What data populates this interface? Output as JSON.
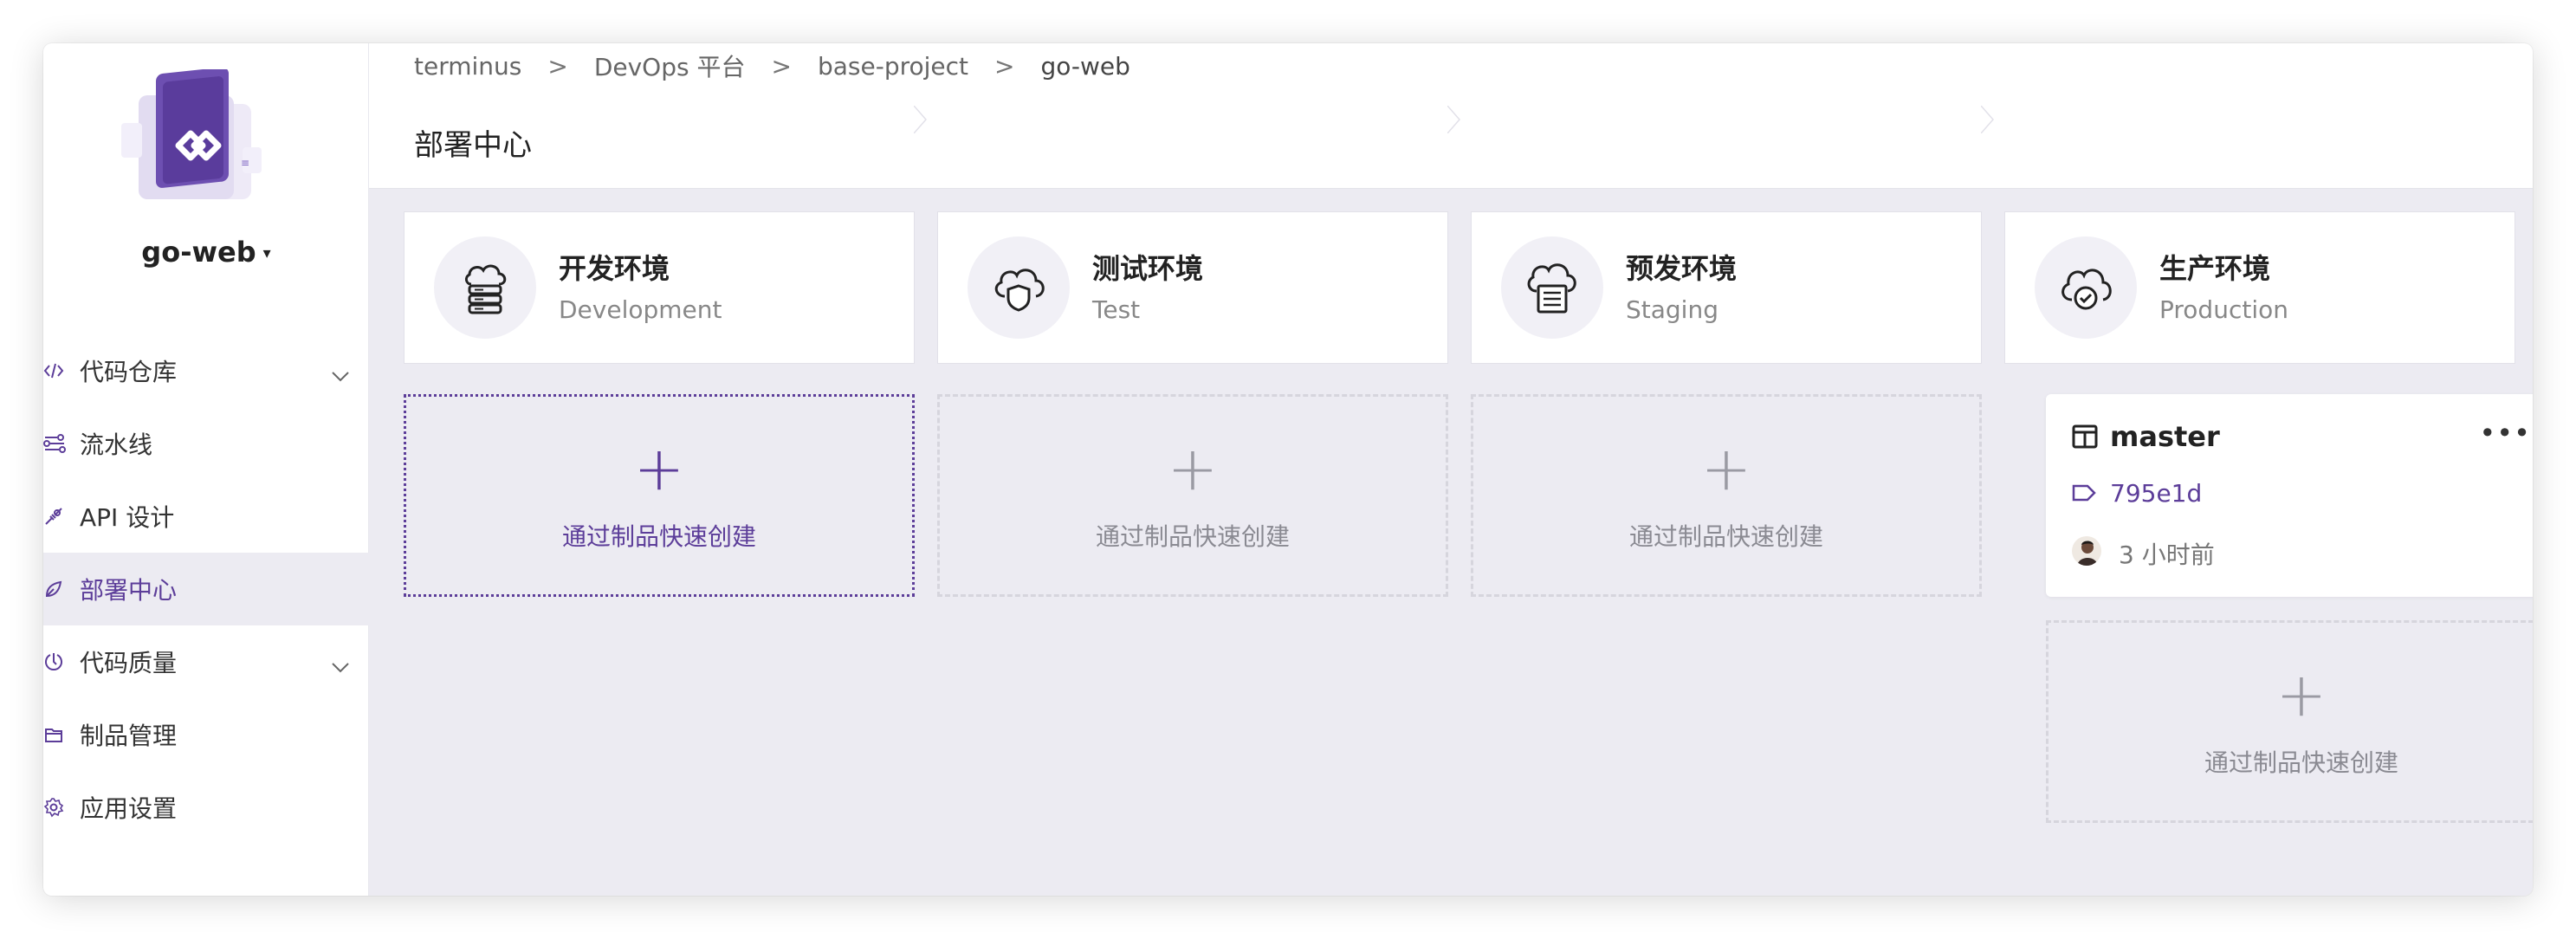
{
  "app": {
    "name": "go-web"
  },
  "sidebar": {
    "items": [
      {
        "label": "代码仓库",
        "icon": "code-icon",
        "expandable": true
      },
      {
        "label": "流水线",
        "icon": "pipeline-icon",
        "expandable": false
      },
      {
        "label": "API 设计",
        "icon": "api-icon",
        "expandable": false
      },
      {
        "label": "部署中心",
        "icon": "deploy-icon",
        "expandable": false,
        "active": true
      },
      {
        "label": "代码质量",
        "icon": "quality-icon",
        "expandable": true
      },
      {
        "label": "制品管理",
        "icon": "artifact-icon",
        "expandable": false
      },
      {
        "label": "应用设置",
        "icon": "settings-icon",
        "expandable": false
      }
    ]
  },
  "breadcrumb": {
    "items": [
      "terminus",
      "DevOps 平台",
      "base-project",
      "go-web"
    ],
    "separator": ">"
  },
  "page": {
    "title": "部署中心"
  },
  "environments": [
    {
      "name": "开发环境",
      "name_en": "Development",
      "icon": "server-cloud-icon"
    },
    {
      "name": "测试环境",
      "name_en": "Test",
      "icon": "shield-cloud-icon"
    },
    {
      "name": "预发环境",
      "name_en": "Staging",
      "icon": "document-cloud-icon"
    },
    {
      "name": "生产环境",
      "name_en": "Production",
      "icon": "check-cloud-icon"
    }
  ],
  "create": {
    "label": "通过制品快速创建",
    "plus": "+"
  },
  "deployment": {
    "branch": "master",
    "commit": "795e1d",
    "time": "3 小时前",
    "more": "•••"
  },
  "colors": {
    "accent": "#5c3d99",
    "background": "#ecebf2",
    "card": "#ffffff"
  }
}
